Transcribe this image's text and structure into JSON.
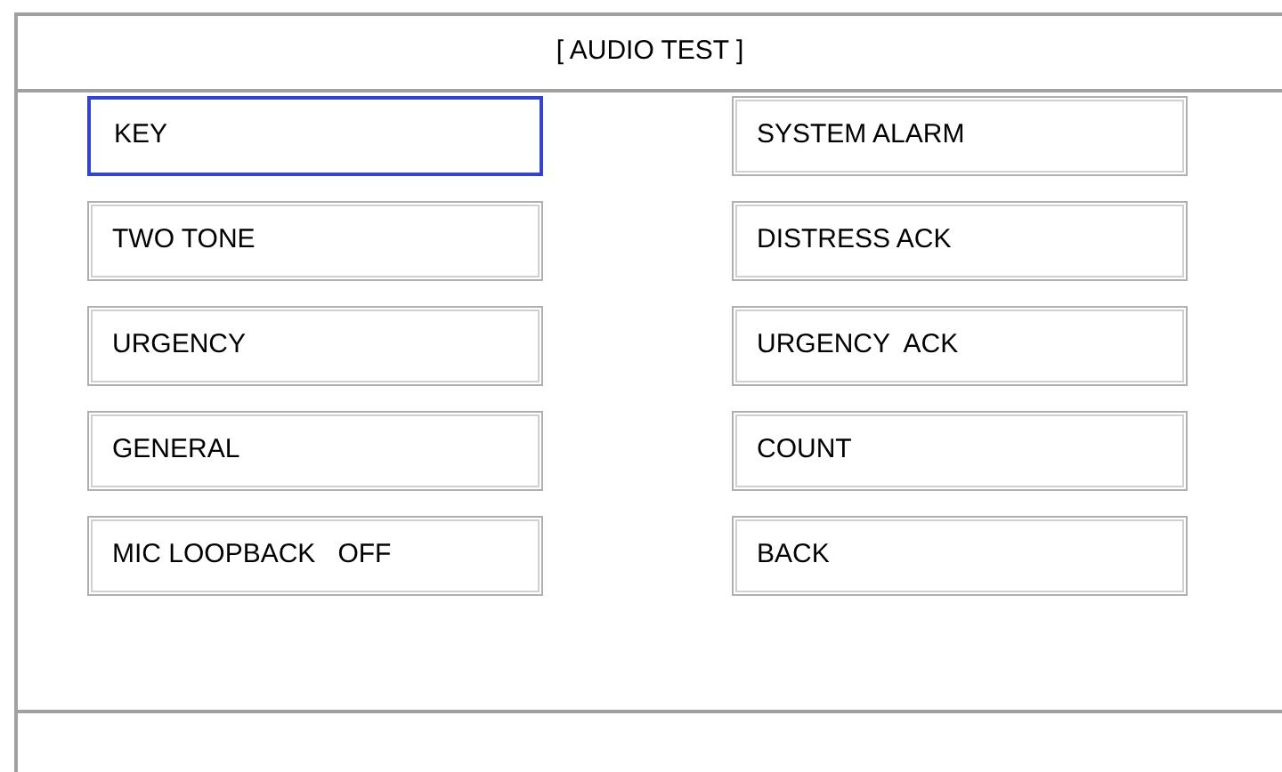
{
  "title": "[ AUDIO TEST ]",
  "buttons": [
    {
      "label": "KEY",
      "selected": true
    },
    {
      "label": "SYSTEM ALARM",
      "selected": false
    },
    {
      "label": "TWO TONE",
      "selected": false
    },
    {
      "label": "DISTRESS ACK",
      "selected": false
    },
    {
      "label": "URGENCY",
      "selected": false
    },
    {
      "label": "URGENCY  ACK",
      "selected": false
    },
    {
      "label": "GENERAL",
      "selected": false
    },
    {
      "label": "COUNT",
      "selected": false
    },
    {
      "label": "MIC LOOPBACK   OFF",
      "selected": false
    },
    {
      "label": "BACK",
      "selected": false
    }
  ]
}
